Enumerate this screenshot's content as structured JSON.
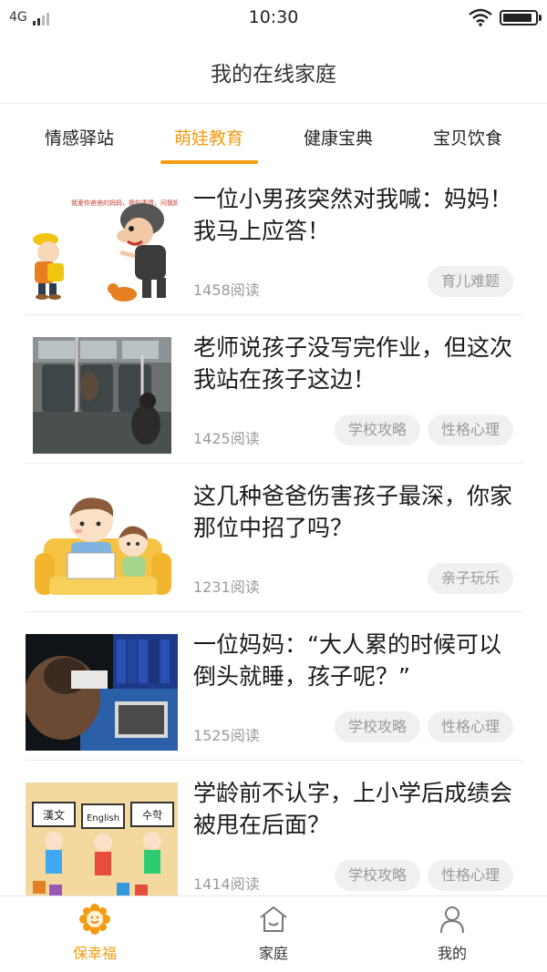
{
  "status_bar": {
    "network": "4G",
    "time": "10:30",
    "signal_icon": "cellular-signal-icon",
    "wifi_icon": "wifi-icon",
    "battery_icon": "battery-icon",
    "battery_level": 0.9
  },
  "header": {
    "title": "我的在线家庭"
  },
  "tabs": [
    {
      "label": "情感驿站"
    },
    {
      "label": "萌娃教育"
    },
    {
      "label": "健康宝典"
    },
    {
      "label": "宝贝饮食"
    }
  ],
  "active_tab_index": 1,
  "articles": [
    {
      "title": "一位小男孩突然对我喊：妈妈！我马上应答！",
      "reads": "1458阅读",
      "tags": [
        "育儿难题"
      ]
    },
    {
      "title": "老师说孩子没写完作业，但这次我站在孩子这边！",
      "reads": "1425阅读",
      "tags": [
        "学校攻略",
        "性格心理"
      ]
    },
    {
      "title": "这几种爸爸伤害孩子最深，你家那位中招了吗？",
      "reads": "1231阅读",
      "tags": [
        "亲子玩乐"
      ]
    },
    {
      "title": "一位妈妈：“大人累的时候可以倒头就睡，孩子呢？”",
      "reads": "1525阅读",
      "tags": [
        "学校攻略",
        "性格心理"
      ]
    },
    {
      "title": "学龄前不认字，上小学后成绩会被甩在后面？",
      "reads": "1414阅读",
      "tags": [
        "学校攻略",
        "性格心理"
      ]
    }
  ],
  "thumbnails": {
    "cartoon_bubble_text": "我爱你爸爸的妈妈，我的事情，问我妈妈去问爸爸！",
    "sign_1": "漢文",
    "sign_2": "English",
    "sign_3": "수학"
  },
  "bottom_nav": [
    {
      "label": "保幸福",
      "icon": "sunflower-smile-icon",
      "active": true
    },
    {
      "label": "家庭",
      "icon": "house-icon",
      "active": false
    },
    {
      "label": "我的",
      "icon": "person-icon",
      "active": false
    }
  ],
  "colors": {
    "accent": "#f39c12",
    "tag_bg": "#f0f0f0",
    "tag_text": "#9a9a9a",
    "divider": "#eaeaea"
  }
}
